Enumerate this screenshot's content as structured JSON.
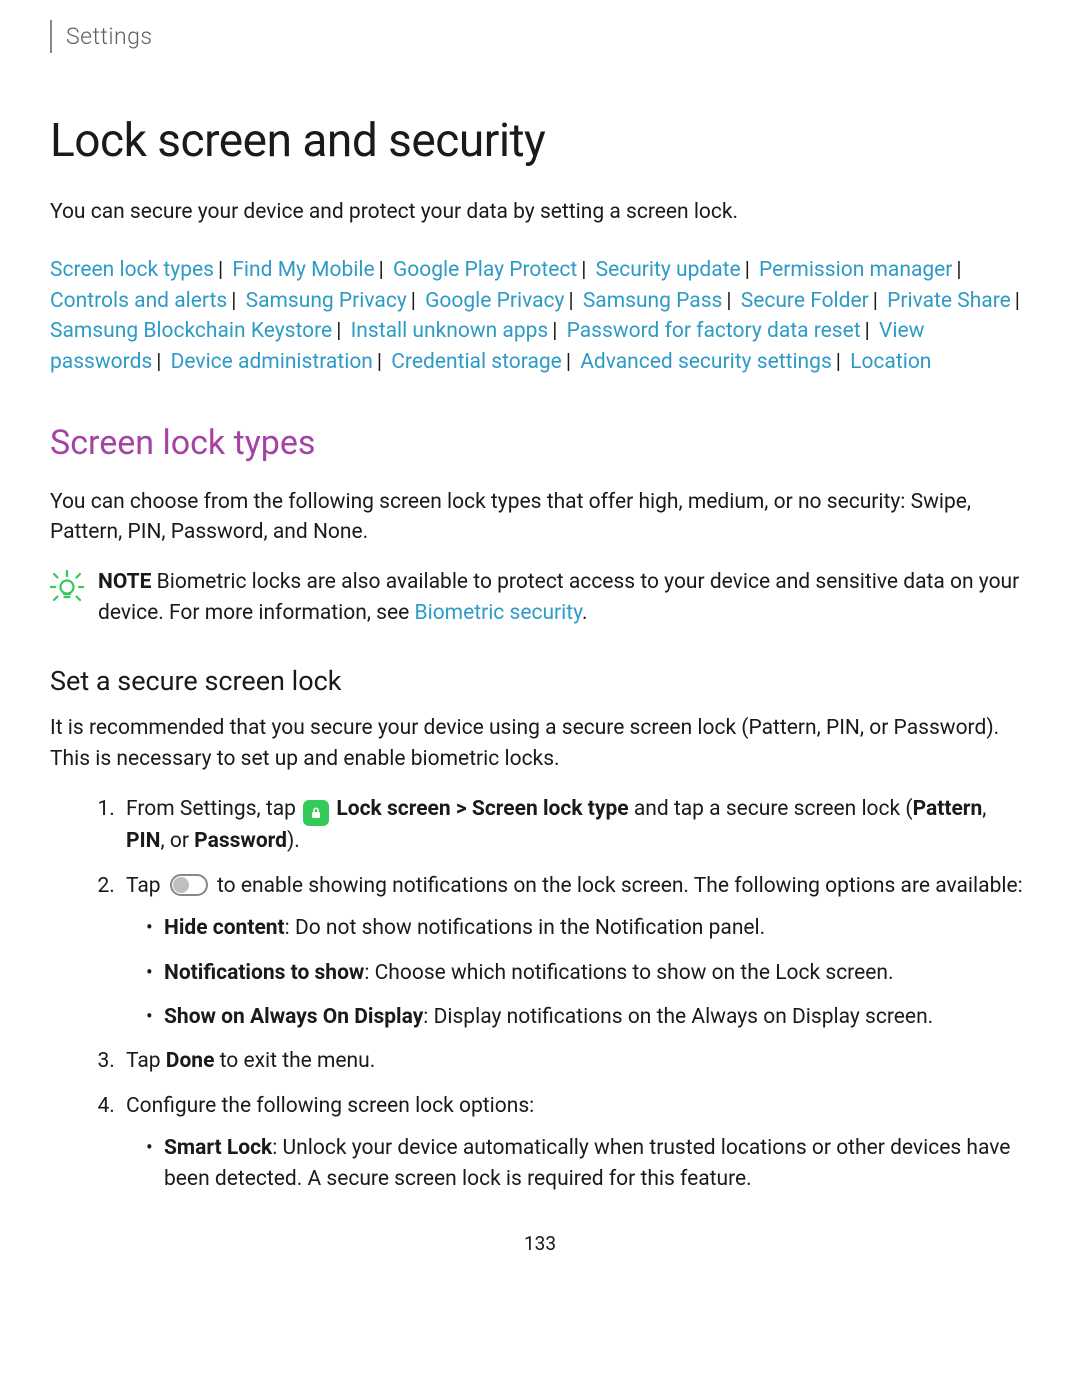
{
  "breadcrumb": "Settings",
  "title": "Lock screen and security",
  "intro": "You can secure your device and protect your data by setting a screen lock.",
  "navlinks": [
    "Screen lock types",
    "Find My Mobile",
    "Google Play Protect",
    "Security update",
    "Permission manager",
    "Controls and alerts",
    "Samsung Privacy",
    "Google Privacy",
    "Samsung Pass",
    "Secure Folder",
    "Private Share",
    "Samsung Blockchain Keystore",
    "Install unknown apps",
    "Password for factory data reset",
    "View passwords",
    "Device administration",
    "Credential storage",
    "Advanced security settings",
    "Location"
  ],
  "section": {
    "heading": "Screen lock types",
    "paragraph": "You can choose from the following screen lock types that offer high, medium, or no security: Swipe, Pattern, PIN, Password, and None."
  },
  "note": {
    "label": "NOTE",
    "text_before": "Biometric locks are also available to protect access to your device and sensitive data on your device. For more information, see ",
    "link": "Biometric security",
    "text_after": "."
  },
  "subsection": {
    "heading": "Set a secure screen lock",
    "paragraph": "It is recommended that you secure your device using a secure screen lock (Pattern, PIN, or Password). This is necessary to set up and enable biometric locks."
  },
  "steps": {
    "step1": {
      "pre": "From Settings, tap ",
      "bold1": "Lock screen > Screen lock type",
      "mid": " and tap a secure screen lock (",
      "bold2": "Pattern",
      "sep1": ", ",
      "bold3": "PIN",
      "sep2": ", or ",
      "bold4": "Password",
      "end": ")."
    },
    "step2": {
      "pre": "Tap ",
      "post": " to enable showing notifications on the lock screen. The following options are available:",
      "bullets": [
        {
          "bold": "Hide content",
          "rest": ": Do not show notifications in the Notification panel."
        },
        {
          "bold": "Notifications to show",
          "rest": ": Choose which notifications to show on the Lock screen."
        },
        {
          "bold": "Show on Always On Display",
          "rest": ": Display notifications on the Always on Display screen."
        }
      ]
    },
    "step3": {
      "pre": "Tap ",
      "bold": "Done",
      "post": " to exit the menu."
    },
    "step4": {
      "text": "Configure the following screen lock options:",
      "bullets": [
        {
          "bold": "Smart Lock",
          "rest": ": Unlock your device automatically when trusted locations or other devices have been detected. A secure screen lock is required for this feature."
        }
      ]
    }
  },
  "page_number": "133"
}
